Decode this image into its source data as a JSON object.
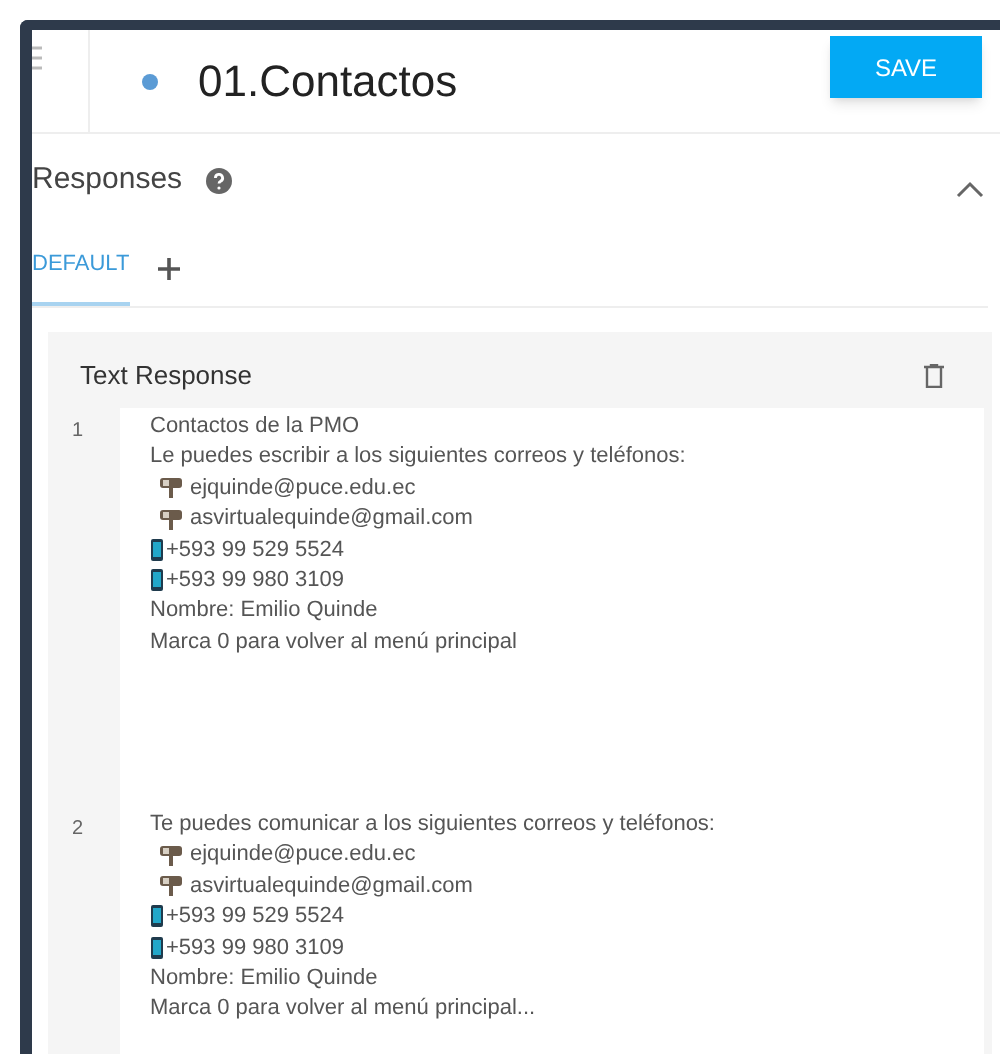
{
  "header": {
    "title": "01.Contactos",
    "save_button": "SAVE"
  },
  "section": {
    "title": "Responses",
    "expanded": true
  },
  "tabs": [
    {
      "label": "DEFAULT",
      "selected": true
    }
  ],
  "card": {
    "title": "Text Response",
    "responses": [
      {
        "number": "1",
        "lines": [
          {
            "kind": "text",
            "text": "Contactos de la PMO"
          },
          {
            "kind": "text",
            "text": "Le puedes escribir a los siguientes correos y teléfonos:"
          },
          {
            "kind": "email",
            "text": "ejquinde@puce.edu.ec"
          },
          {
            "kind": "email",
            "text": "asvirtualequinde@gmail.com"
          },
          {
            "kind": "phone",
            "text": "+593 99 529 5524"
          },
          {
            "kind": "phone",
            "text": "+593 99 980 3109"
          },
          {
            "kind": "text",
            "text": "Nombre: Emilio Quinde"
          },
          {
            "kind": "text",
            "text": "Marca 0 para volver al menú principal"
          }
        ]
      },
      {
        "number": "2",
        "lines": [
          {
            "kind": "text",
            "text": "Te puedes comunicar a los siguientes correos y teléfonos:"
          },
          {
            "kind": "email",
            "text": "ejquinde@puce.edu.ec"
          },
          {
            "kind": "email",
            "text": "asvirtualequinde@gmail.com"
          },
          {
            "kind": "phone",
            "text": "+593 99 529 5524"
          },
          {
            "kind": "phone",
            "text": "+593 99 980 3109"
          },
          {
            "kind": "text",
            "text": "Nombre: Emilio Quinde"
          },
          {
            "kind": "text",
            "text": "Marca 0 para volver al menú principal..."
          }
        ]
      }
    ]
  }
}
